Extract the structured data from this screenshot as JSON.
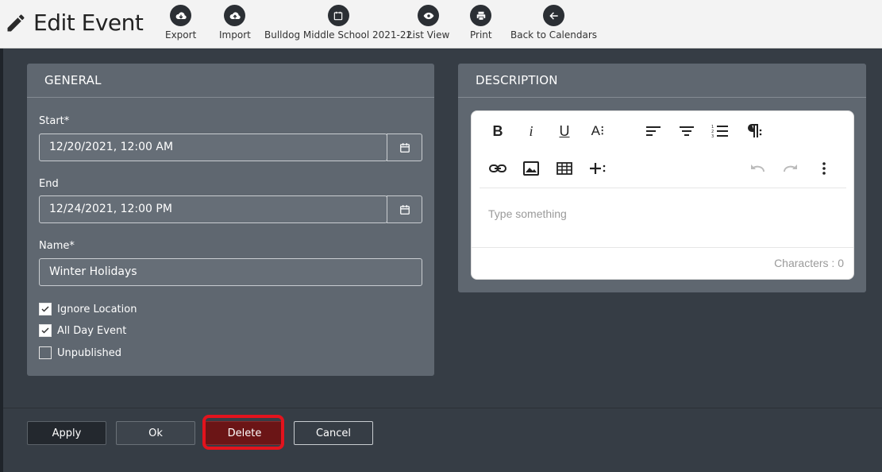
{
  "header": {
    "title": "Edit Event",
    "toolbar": [
      {
        "label": "Export",
        "icon": "cloud-download-icon"
      },
      {
        "label": "Import",
        "icon": "cloud-upload-icon"
      },
      {
        "label": "Bulldog Middle School 2021-22",
        "icon": "calendar-icon"
      },
      {
        "label": "List View",
        "icon": "eye-icon"
      },
      {
        "label": "Print",
        "icon": "printer-icon"
      },
      {
        "label": "Back to Calendars",
        "icon": "arrow-left-icon"
      }
    ]
  },
  "general": {
    "heading": "GENERAL",
    "start_label": "Start*",
    "start_value": "12/20/2021, 12:00 AM",
    "end_label": "End",
    "end_value": "12/24/2021, 12:00 PM",
    "name_label": "Name*",
    "name_value": "Winter Holidays",
    "checkboxes": [
      {
        "label": "Ignore Location",
        "checked": true
      },
      {
        "label": "All Day Event",
        "checked": true
      },
      {
        "label": "Unpublished",
        "checked": false
      }
    ]
  },
  "description": {
    "heading": "DESCRIPTION",
    "placeholder": "Type something",
    "char_count": "Characters : 0",
    "toolbar_row1": [
      "B",
      "i",
      "U",
      "A⁝"
    ],
    "toolbar_icons": [
      "bold-icon",
      "italic-icon",
      "underline-icon",
      "font-size-icon",
      "align-left-icon",
      "align-center-icon",
      "ordered-list-icon",
      "paragraph-icon",
      "link-icon",
      "image-icon",
      "table-icon",
      "insert-icon",
      "undo-icon",
      "redo-icon",
      "more-icon"
    ]
  },
  "footer": {
    "apply": "Apply",
    "ok": "Ok",
    "delete": "Delete",
    "cancel": "Cancel"
  },
  "colors": {
    "delete_bg": "#6b1516",
    "highlight": "#e3131d",
    "panel_bg": "#5f6770"
  }
}
